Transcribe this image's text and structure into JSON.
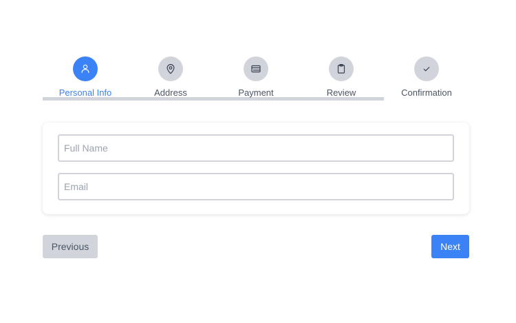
{
  "stepper": {
    "steps": [
      {
        "label": "Personal Info",
        "icon": "user-icon",
        "active": true
      },
      {
        "label": "Address",
        "icon": "map-pin-icon",
        "active": false
      },
      {
        "label": "Payment",
        "icon": "credit-card-icon",
        "active": false
      },
      {
        "label": "Review",
        "icon": "clipboard-icon",
        "active": false
      },
      {
        "label": "Confirmation",
        "icon": "check-icon",
        "active": false
      }
    ]
  },
  "form": {
    "full_name": {
      "value": "",
      "placeholder": "Full Name"
    },
    "email": {
      "value": "",
      "placeholder": "Email"
    }
  },
  "buttons": {
    "previous_label": "Previous",
    "next_label": "Next"
  },
  "colors": {
    "accent": "#3b82f6",
    "inactive_step": "#d1d5db",
    "disabled_button": "#d1d5db"
  }
}
